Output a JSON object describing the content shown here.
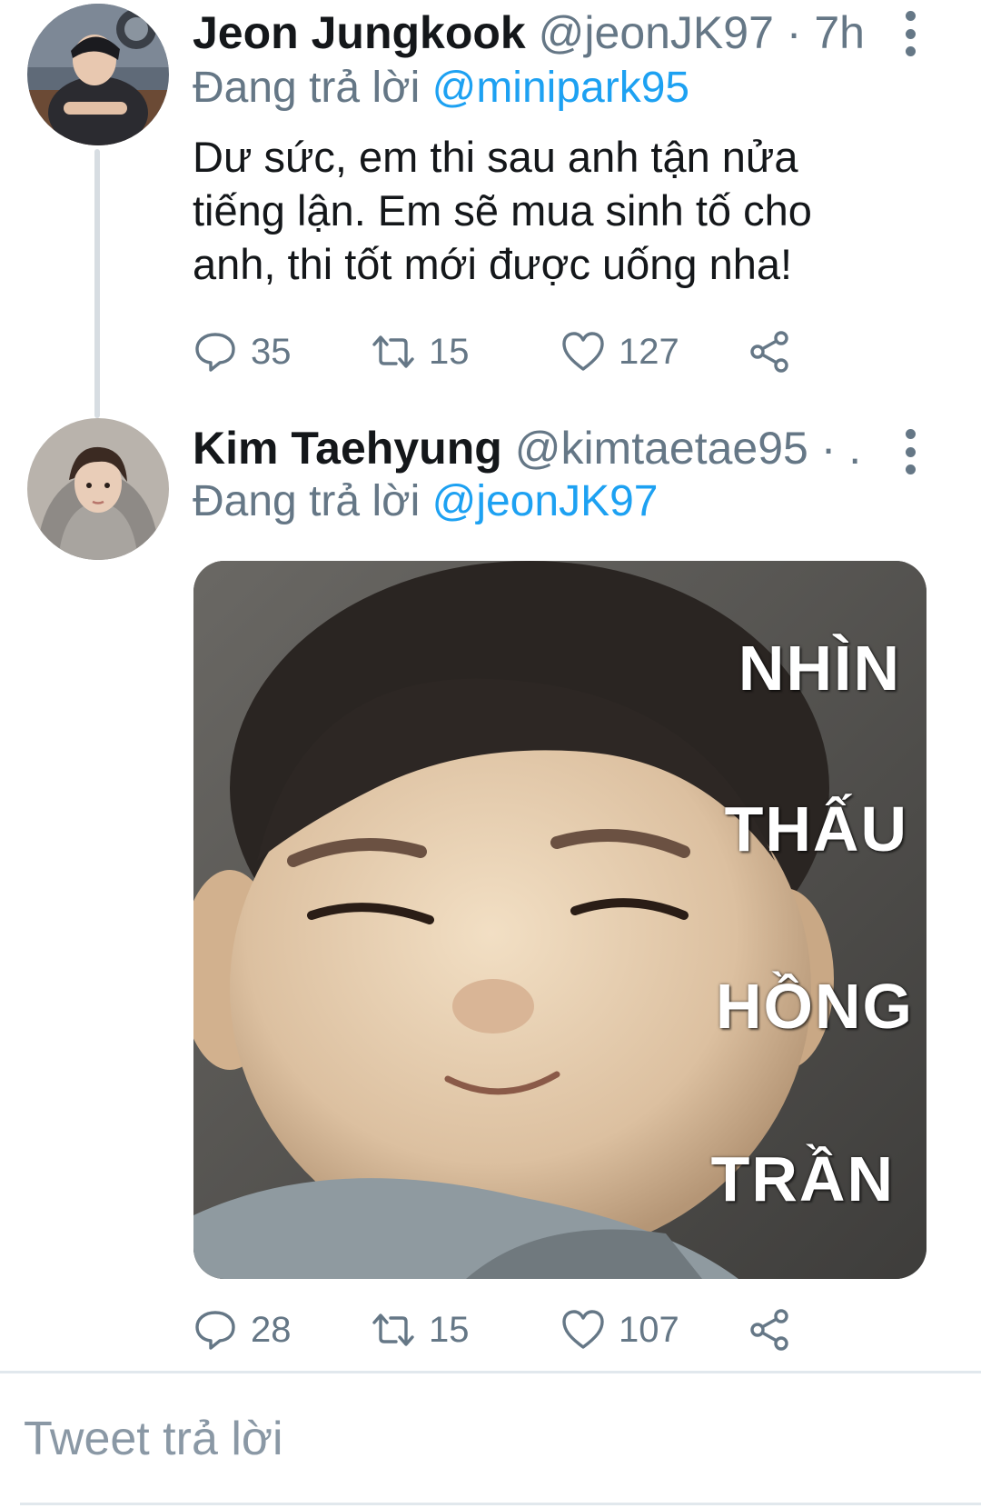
{
  "tweets": [
    {
      "display_name": "Jeon Jungkook",
      "handle_meta": "@jeonJK97 · 7h",
      "reply_prefix": "Đang trả lời",
      "reply_to": "@minipark95",
      "text": "Dư sức, em thi sau anh tận nửa tiếng lận. Em sẽ mua sinh tố cho anh, thi tốt mới được uống nha!",
      "reply_count": "35",
      "retweet_count": "15",
      "like_count": "127"
    },
    {
      "display_name": "Kim Taehyung",
      "handle_meta": "@kimtaetae95 · ...",
      "reply_prefix": "Đang trả lời",
      "reply_to": "@jeonJK97",
      "media_text": [
        "NHÌN",
        "THẤU",
        "HỒNG",
        "TRẦN"
      ],
      "reply_count": "28",
      "retweet_count": "15",
      "like_count": "107"
    }
  ],
  "composer": {
    "placeholder": "Tweet trả lời"
  },
  "icons": {
    "more": "more-vertical-icon",
    "reply": "reply-bubble-icon",
    "retweet": "retweet-icon",
    "like": "heart-icon",
    "share": "share-icon"
  },
  "colors": {
    "link": "#1da1f2",
    "secondary_text": "#657786",
    "divider": "#e1e8ed"
  }
}
